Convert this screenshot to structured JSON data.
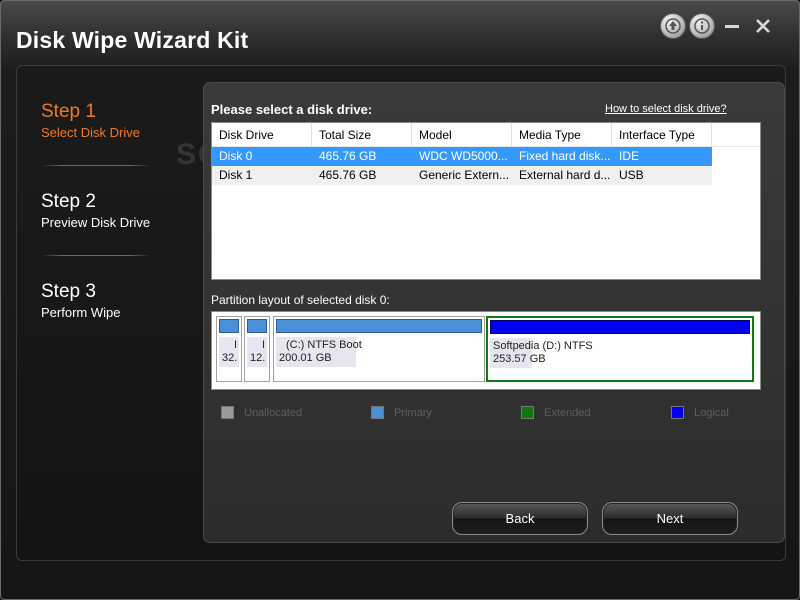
{
  "window": {
    "title": "Disk Wipe Wizard Kit",
    "buttons": [
      "update-icon",
      "info-icon",
      "minimize-icon",
      "close-icon"
    ]
  },
  "steps": [
    {
      "num": "Step 1",
      "label": "Select Disk Drive",
      "active": true
    },
    {
      "num": "Step 2",
      "label": "Preview Disk Drive",
      "active": false
    },
    {
      "num": "Step 3",
      "label": "Perform Wipe",
      "active": false
    }
  ],
  "main": {
    "heading": "Please select a disk drive:",
    "help_link": "How to select disk drive?",
    "table": {
      "columns": [
        "Disk Drive",
        "Total Size",
        "Model",
        "Media Type",
        "Interface Type"
      ],
      "rows": [
        [
          "Disk 0",
          "465.76 GB",
          "WDC WD5000...",
          "Fixed hard disk...",
          "IDE"
        ],
        [
          "Disk 1",
          "465.76 GB",
          "Generic Extern...",
          "External hard d...",
          "USB"
        ]
      ],
      "selected_row": 0
    },
    "partition_label": "Partition layout of selected disk 0:",
    "partitions": [
      {
        "lines": [
          "I",
          "32."
        ],
        "type": "primary"
      },
      {
        "lines": [
          "I",
          "12."
        ],
        "type": "primary"
      },
      {
        "lines": [
          "(C:)  NTFS  Boot",
          "200.01 GB"
        ],
        "type": "primary"
      },
      {
        "lines": [
          "Softpedia  (D:)  NTFS",
          "253.57 GB"
        ],
        "type": "logical"
      }
    ],
    "legend": [
      {
        "label": "Unallocated",
        "color": "#9a9a9a"
      },
      {
        "label": "Primary",
        "color": "#4a90d9"
      },
      {
        "label": "Extended",
        "color": "#0a7a0a"
      },
      {
        "label": "Logical",
        "color": "#0000ee"
      }
    ],
    "back_label": "Back",
    "next_label": "Next"
  },
  "colors": {
    "accent": "#f07a22",
    "selection": "#3399ff"
  },
  "watermark": "SOFTPEDIA"
}
